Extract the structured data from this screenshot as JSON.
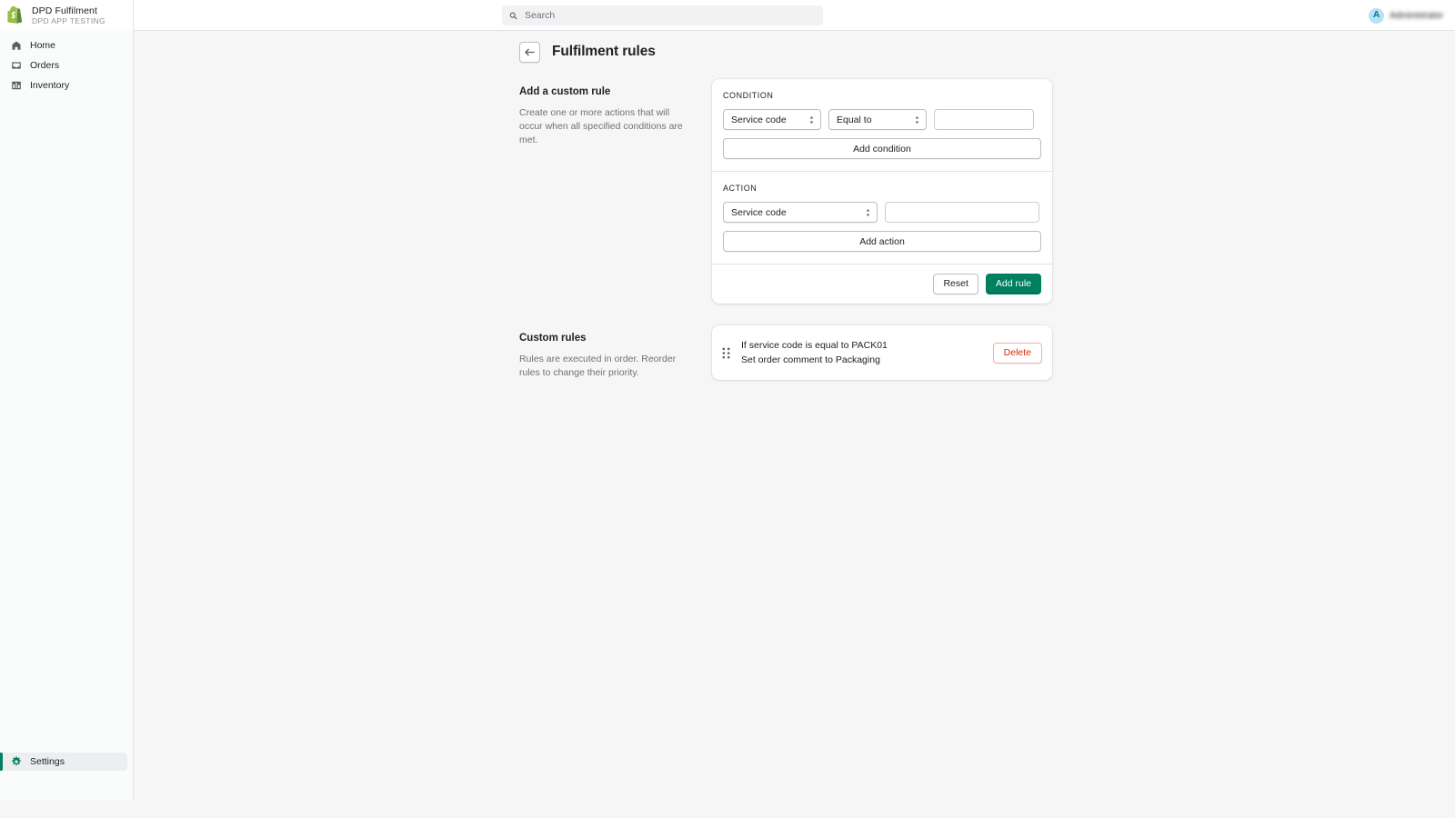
{
  "topbar": {
    "logo_icon": "shopify-bag-icon",
    "app_title": "DPD Fulfilment",
    "app_subtitle": "DPD APP TESTING",
    "search": {
      "icon": "search-icon",
      "placeholder": "Search",
      "value": ""
    },
    "account": {
      "avatar_initial": "A",
      "name": "Administrator",
      "avatar_bg": "#b3e3f5",
      "avatar_fg": "#0e6e8c"
    }
  },
  "sidebar": {
    "items": [
      {
        "label": "Home",
        "icon": "home-icon",
        "selected": false
      },
      {
        "label": "Orders",
        "icon": "orders-icon",
        "selected": false
      },
      {
        "label": "Inventory",
        "icon": "inventory-icon",
        "selected": false
      }
    ],
    "bottom": {
      "label": "Settings",
      "icon": "gear-icon",
      "selected": true
    },
    "accent": "#008060"
  },
  "page": {
    "back_icon": "arrow-left-icon",
    "title": "Fulfilment rules"
  },
  "add_rule": {
    "aside_title": "Add a custom rule",
    "aside_desc": "Create one or more actions that will occur when all specified conditions are met.",
    "condition": {
      "label": "CONDITION",
      "field_select": {
        "value": "Service code",
        "icon": "chevron-updown-icon"
      },
      "operator_select": {
        "value": "Equal to",
        "icon": "chevron-updown-icon"
      },
      "value_input": {
        "value": "",
        "placeholder": ""
      },
      "add_button": "Add condition"
    },
    "action": {
      "label": "ACTION",
      "field_select": {
        "value": "Service code",
        "icon": "chevron-updown-icon"
      },
      "value_input": {
        "value": "",
        "placeholder": ""
      },
      "add_button": "Add action"
    },
    "footer": {
      "reset_label": "Reset",
      "submit_label": "Add rule",
      "submit_color": "#008060"
    }
  },
  "custom_rules": {
    "aside_title": "Custom rules",
    "aside_desc": "Rules are executed in order. Reorder rules to change their priority.",
    "rows": [
      {
        "drag_icon": "drag-handle-icon",
        "condition_text": "If service code is equal to PACK01",
        "action_text": "Set order comment to Packaging",
        "delete_label": "Delete",
        "delete_color": "#d72c0d"
      }
    ]
  }
}
